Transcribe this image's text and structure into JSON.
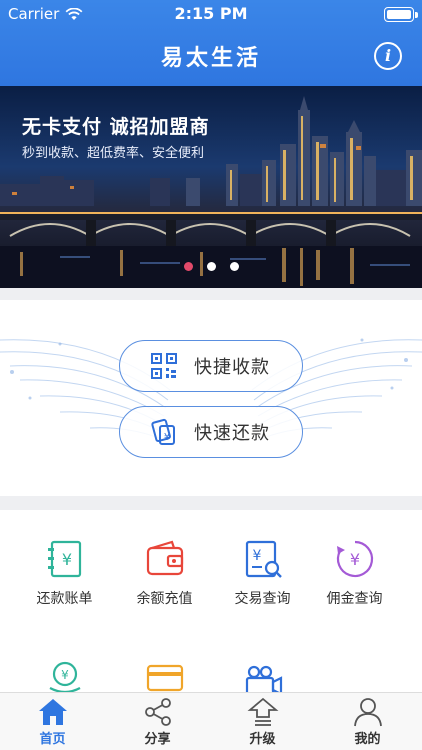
{
  "status_bar": {
    "carrier": "Carrier",
    "time": "2:15 PM"
  },
  "header": {
    "title": "易太生活",
    "info_icon": "info-icon"
  },
  "banner": {
    "headline": "无卡支付 诚招加盟商",
    "subline": "秒到收款、超低费率、安全便利",
    "active_dot": 1,
    "dot_count": 3
  },
  "actions": [
    {
      "label": "快捷收款",
      "icon": "qr-code-icon"
    },
    {
      "label": "快速还款",
      "icon": "card-repay-icon"
    }
  ],
  "services": [
    {
      "label": "还款账单",
      "icon": "bill-icon",
      "color": "#2fb49a"
    },
    {
      "label": "余额充值",
      "icon": "wallet-icon",
      "color": "#e8463a"
    },
    {
      "label": "交易查询",
      "icon": "transaction-search-icon",
      "color": "#2f6fd9"
    },
    {
      "label": "佣金查询",
      "icon": "commission-icon",
      "color": "#a45ad6"
    },
    {
      "label": "",
      "icon": "coin-stack-icon",
      "color": "#2fb49a"
    },
    {
      "label": "",
      "icon": "card-icon",
      "color": "#f0a52a"
    },
    {
      "label": "",
      "icon": "video-icon",
      "color": "#2f6fd9"
    }
  ],
  "tabbar": {
    "active": "home",
    "tabs": [
      {
        "key": "home",
        "label": "首页",
        "icon": "home-icon"
      },
      {
        "key": "share",
        "label": "分享",
        "icon": "share-icon"
      },
      {
        "key": "upgrade",
        "label": "升级",
        "icon": "upgrade-icon"
      },
      {
        "key": "mine",
        "label": "我的",
        "icon": "user-icon"
      }
    ]
  },
  "colors": {
    "brand_blue": "#2f76e0",
    "active_dot": "#e24a6a",
    "pill_border": "#5a8fe0"
  }
}
